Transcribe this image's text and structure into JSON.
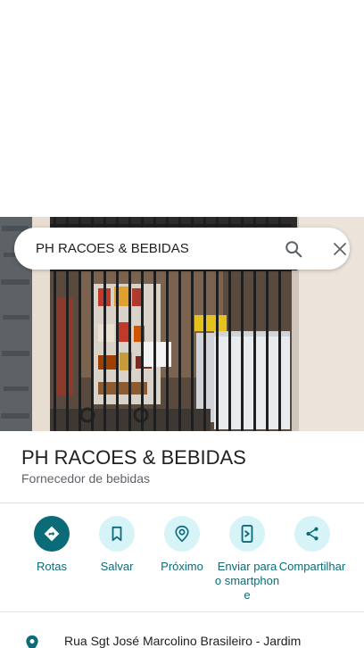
{
  "search": {
    "query": "PH RACOES & BEBIDAS"
  },
  "place": {
    "name": "PH RACOES & BEBIDAS",
    "category": "Fornecedor de bebidas"
  },
  "actions": [
    {
      "label": "Rotas",
      "icon": "directions-icon"
    },
    {
      "label": "Salvar",
      "icon": "bookmark-icon"
    },
    {
      "label": "Próximo",
      "icon": "nearby-icon"
    },
    {
      "label": "Enviar para o smartphone",
      "icon": "send-to-phone-icon"
    },
    {
      "label": "Compartilhar",
      "icon": "share-icon"
    }
  ],
  "address": {
    "text": "Rua Sgt José Marcolino Brasileiro - Jardim"
  },
  "colors": {
    "accent": "#0b6b78",
    "accent_light": "#d6f3f8"
  }
}
